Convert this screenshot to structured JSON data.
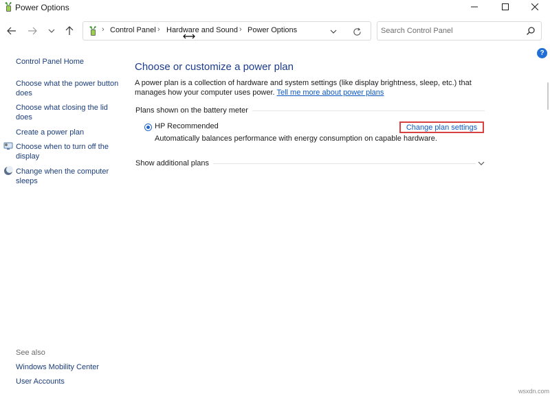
{
  "window": {
    "title": "Power Options"
  },
  "addressbar": {
    "crumbs": [
      "Control Panel",
      "Hardware and Sound",
      "Power Options"
    ]
  },
  "search": {
    "placeholder": "Search Control Panel"
  },
  "help": {
    "label": "?"
  },
  "sidebar": {
    "items": [
      {
        "label": "Control Panel Home"
      },
      {
        "label": "Choose what the power button does"
      },
      {
        "label": "Choose what closing the lid does"
      },
      {
        "label": "Create a power plan"
      },
      {
        "label": "Choose when to turn off the display"
      },
      {
        "label": "Change when the computer sleeps"
      }
    ],
    "see_also_heading": "See also",
    "see_also": [
      {
        "label": "Windows Mobility Center"
      },
      {
        "label": "User Accounts"
      }
    ]
  },
  "main": {
    "title": "Choose or customize a power plan",
    "description": "A power plan is a collection of hardware and system settings (like display brightness, sleep, etc.) that manages how your computer uses power.",
    "learn_more": "Tell me more about power plans",
    "section_label": "Plans shown on the battery meter",
    "plan": {
      "name": "HP Recommended",
      "description": "Automatically balances performance with energy consumption on capable hardware.",
      "change_link": "Change plan settings",
      "selected": true
    },
    "show_additional": "Show additional plans"
  },
  "watermark": "wsxdn.com",
  "colors": {
    "link": "#0b57c2",
    "title": "#1a3a8a",
    "highlight_box": "#d94040",
    "radio": "#1f63c8"
  }
}
